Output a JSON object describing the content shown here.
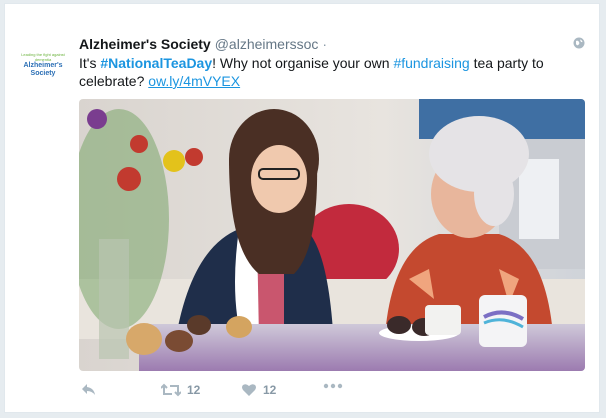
{
  "tweet": {
    "display_name": "Alzheimer's Society",
    "handle": "@alzheimerssoc",
    "separator": "·",
    "text_part1": "It's ",
    "hashtag1": "#NationalTeaDay",
    "text_part2": "! Why not organise your own ",
    "hashtag2": "#fundraising",
    "text_part3": " tea party to celebrate? ",
    "link": "ow.ly/4mVYEX",
    "avatar_tagline": "Leading the fight against dementia",
    "avatar_brand_line1": "Alzheimer's",
    "avatar_brand_line2": "Society",
    "retweet_count": "12",
    "like_count": "12"
  },
  "icons": {
    "globe": "globe-icon",
    "reply": "reply-icon",
    "retweet": "retweet-icon",
    "like": "heart-icon",
    "more": "more-icon"
  },
  "colors": {
    "link": "#1b95e0",
    "name": "#14171a",
    "muted": "#8899a6",
    "brand_blue": "#2b6fb5",
    "brand_green": "#6cb33e"
  }
}
